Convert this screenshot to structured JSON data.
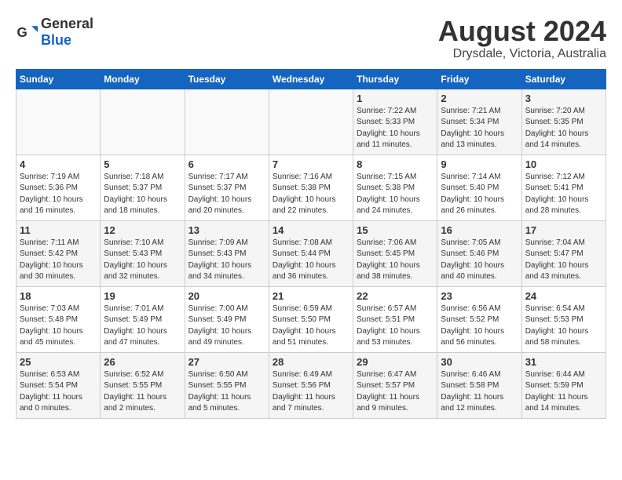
{
  "header": {
    "logo_general": "General",
    "logo_blue": "Blue",
    "title": "August 2024",
    "subtitle": "Drysdale, Victoria, Australia"
  },
  "weekdays": [
    "Sunday",
    "Monday",
    "Tuesday",
    "Wednesday",
    "Thursday",
    "Friday",
    "Saturday"
  ],
  "weeks": [
    [
      {
        "day": "",
        "info": ""
      },
      {
        "day": "",
        "info": ""
      },
      {
        "day": "",
        "info": ""
      },
      {
        "day": "",
        "info": ""
      },
      {
        "day": "1",
        "info": "Sunrise: 7:22 AM\nSunset: 5:33 PM\nDaylight: 10 hours\nand 11 minutes."
      },
      {
        "day": "2",
        "info": "Sunrise: 7:21 AM\nSunset: 5:34 PM\nDaylight: 10 hours\nand 13 minutes."
      },
      {
        "day": "3",
        "info": "Sunrise: 7:20 AM\nSunset: 5:35 PM\nDaylight: 10 hours\nand 14 minutes."
      }
    ],
    [
      {
        "day": "4",
        "info": "Sunrise: 7:19 AM\nSunset: 5:36 PM\nDaylight: 10 hours\nand 16 minutes."
      },
      {
        "day": "5",
        "info": "Sunrise: 7:18 AM\nSunset: 5:37 PM\nDaylight: 10 hours\nand 18 minutes."
      },
      {
        "day": "6",
        "info": "Sunrise: 7:17 AM\nSunset: 5:37 PM\nDaylight: 10 hours\nand 20 minutes."
      },
      {
        "day": "7",
        "info": "Sunrise: 7:16 AM\nSunset: 5:38 PM\nDaylight: 10 hours\nand 22 minutes."
      },
      {
        "day": "8",
        "info": "Sunrise: 7:15 AM\nSunset: 5:38 PM\nDaylight: 10 hours\nand 24 minutes."
      },
      {
        "day": "9",
        "info": "Sunrise: 7:14 AM\nSunset: 5:40 PM\nDaylight: 10 hours\nand 26 minutes."
      },
      {
        "day": "10",
        "info": "Sunrise: 7:12 AM\nSunset: 5:41 PM\nDaylight: 10 hours\nand 28 minutes."
      }
    ],
    [
      {
        "day": "11",
        "info": "Sunrise: 7:11 AM\nSunset: 5:42 PM\nDaylight: 10 hours\nand 30 minutes."
      },
      {
        "day": "12",
        "info": "Sunrise: 7:10 AM\nSunset: 5:43 PM\nDaylight: 10 hours\nand 32 minutes."
      },
      {
        "day": "13",
        "info": "Sunrise: 7:09 AM\nSunset: 5:43 PM\nDaylight: 10 hours\nand 34 minutes."
      },
      {
        "day": "14",
        "info": "Sunrise: 7:08 AM\nSunset: 5:44 PM\nDaylight: 10 hours\nand 36 minutes."
      },
      {
        "day": "15",
        "info": "Sunrise: 7:06 AM\nSunset: 5:45 PM\nDaylight: 10 hours\nand 38 minutes."
      },
      {
        "day": "16",
        "info": "Sunrise: 7:05 AM\nSunset: 5:46 PM\nDaylight: 10 hours\nand 40 minutes."
      },
      {
        "day": "17",
        "info": "Sunrise: 7:04 AM\nSunset: 5:47 PM\nDaylight: 10 hours\nand 43 minutes."
      }
    ],
    [
      {
        "day": "18",
        "info": "Sunrise: 7:03 AM\nSunset: 5:48 PM\nDaylight: 10 hours\nand 45 minutes."
      },
      {
        "day": "19",
        "info": "Sunrise: 7:01 AM\nSunset: 5:49 PM\nDaylight: 10 hours\nand 47 minutes."
      },
      {
        "day": "20",
        "info": "Sunrise: 7:00 AM\nSunset: 5:49 PM\nDaylight: 10 hours\nand 49 minutes."
      },
      {
        "day": "21",
        "info": "Sunrise: 6:59 AM\nSunset: 5:50 PM\nDaylight: 10 hours\nand 51 minutes."
      },
      {
        "day": "22",
        "info": "Sunrise: 6:57 AM\nSunset: 5:51 PM\nDaylight: 10 hours\nand 53 minutes."
      },
      {
        "day": "23",
        "info": "Sunrise: 6:56 AM\nSunset: 5:52 PM\nDaylight: 10 hours\nand 56 minutes."
      },
      {
        "day": "24",
        "info": "Sunrise: 6:54 AM\nSunset: 5:53 PM\nDaylight: 10 hours\nand 58 minutes."
      }
    ],
    [
      {
        "day": "25",
        "info": "Sunrise: 6:53 AM\nSunset: 5:54 PM\nDaylight: 11 hours\nand 0 minutes."
      },
      {
        "day": "26",
        "info": "Sunrise: 6:52 AM\nSunset: 5:55 PM\nDaylight: 11 hours\nand 2 minutes."
      },
      {
        "day": "27",
        "info": "Sunrise: 6:50 AM\nSunset: 5:55 PM\nDaylight: 11 hours\nand 5 minutes."
      },
      {
        "day": "28",
        "info": "Sunrise: 6:49 AM\nSunset: 5:56 PM\nDaylight: 11 hours\nand 7 minutes."
      },
      {
        "day": "29",
        "info": "Sunrise: 6:47 AM\nSunset: 5:57 PM\nDaylight: 11 hours\nand 9 minutes."
      },
      {
        "day": "30",
        "info": "Sunrise: 6:46 AM\nSunset: 5:58 PM\nDaylight: 11 hours\nand 12 minutes."
      },
      {
        "day": "31",
        "info": "Sunrise: 6:44 AM\nSunset: 5:59 PM\nDaylight: 11 hours\nand 14 minutes."
      }
    ]
  ]
}
